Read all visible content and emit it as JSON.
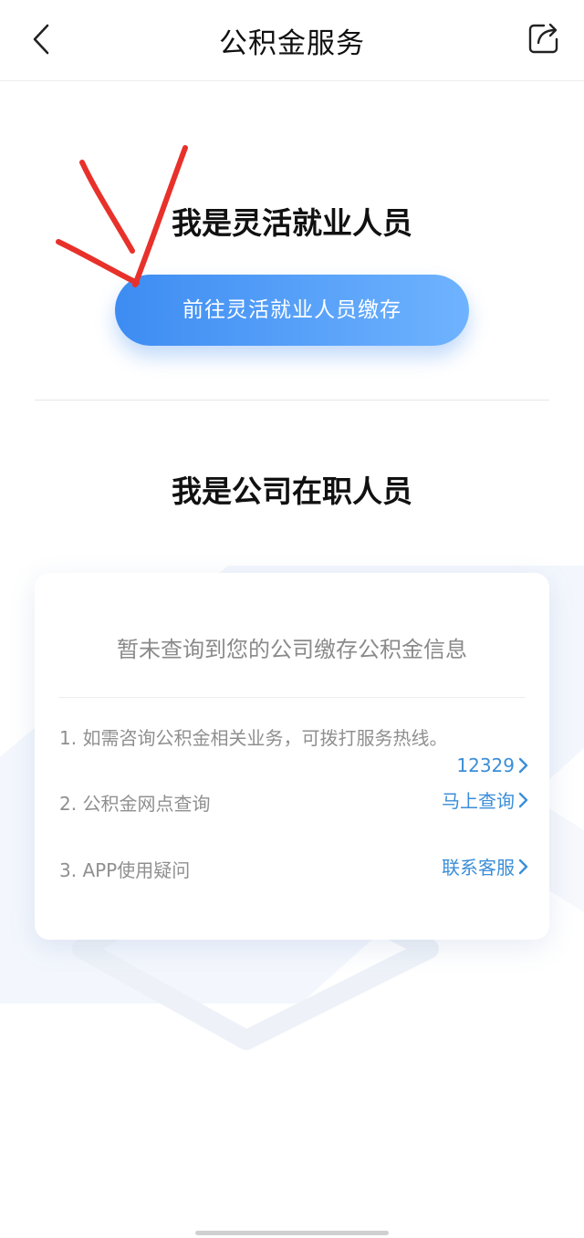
{
  "header": {
    "title": "公积金服务",
    "back_icon": "chevron-left-icon",
    "share_icon": "share-icon"
  },
  "flexible": {
    "title": "我是灵活就业人员",
    "button_label": "前往灵活就业人员缴存"
  },
  "company": {
    "title": "我是公司在职人员"
  },
  "card": {
    "title": "暂未查询到您的公司缴存公积金信息",
    "items": [
      {
        "text": "1. 如需咨询公积金相关业务，可拨打服务热线。",
        "link": "12329"
      },
      {
        "text": "2. 公积金网点查询",
        "link": "马上查询"
      },
      {
        "text": "3. APP使用疑问",
        "link": "联系客服"
      }
    ]
  },
  "colors": {
    "primary_gradient_start": "#3d8cf2",
    "primary_gradient_end": "#6fb3ff",
    "link": "#3b8ed8",
    "annotation_red": "#e8312a"
  }
}
